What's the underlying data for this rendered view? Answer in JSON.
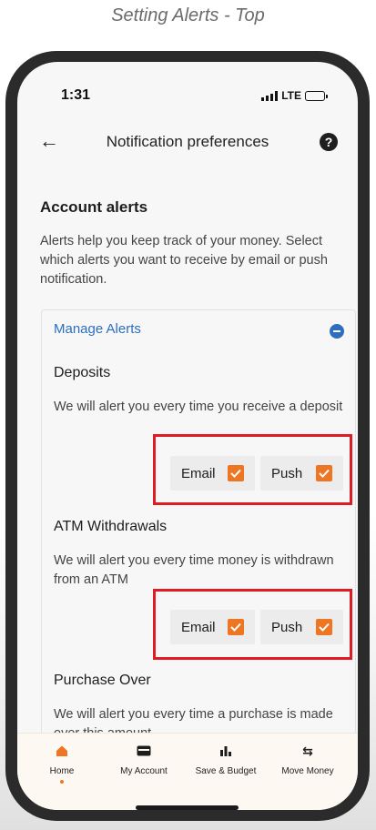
{
  "caption": "Setting Alerts - Top",
  "status": {
    "time": "1:31",
    "network": "LTE"
  },
  "header": {
    "title": "Notification preferences",
    "back_icon": "arrow-left-icon",
    "help_icon": "question-icon"
  },
  "section": {
    "title": "Account alerts",
    "description": "Alerts help you keep track of your money. Select which alerts you want to receive by email or push notification."
  },
  "manage": {
    "label": "Manage Alerts"
  },
  "alerts": [
    {
      "title": "Deposits",
      "description": "We will alert you every time you receive a deposit",
      "email_label": "Email",
      "push_label": "Push",
      "email_checked": true,
      "push_checked": true
    },
    {
      "title": "ATM Withdrawals",
      "description": "We will alert you every time money is withdrawn from an ATM",
      "email_label": "Email",
      "push_label": "Push",
      "email_checked": true,
      "push_checked": true
    },
    {
      "title": "Purchase Over",
      "description": "We will alert you every time a purchase is made over this amount"
    }
  ],
  "tabs": [
    {
      "label": "Home",
      "icon": "home-icon",
      "active": true
    },
    {
      "label": "My Account",
      "icon": "card-icon"
    },
    {
      "label": "Save & Budget",
      "icon": "chart-icon"
    },
    {
      "label": "Move Money",
      "icon": "transfer-icon"
    }
  ],
  "colors": {
    "accent": "#ee7623",
    "link": "#2d6ec0",
    "highlight": "#e01b24"
  }
}
